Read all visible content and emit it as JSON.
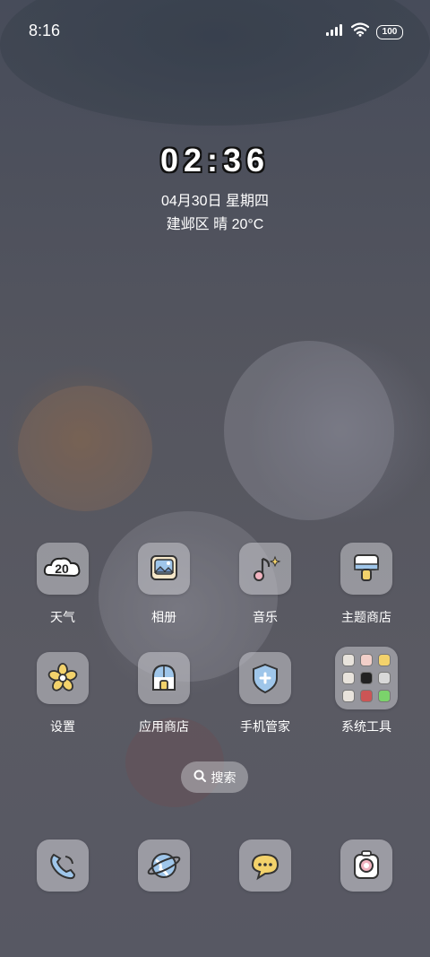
{
  "status_bar": {
    "time": "8:16",
    "battery": "100"
  },
  "clock": {
    "time": "02:36",
    "date": "04月30日 星期四",
    "weather": "建邺区 晴 20°C"
  },
  "apps": [
    {
      "label": "天气",
      "icon": "weather-icon",
      "badge": "20"
    },
    {
      "label": "相册",
      "icon": "gallery-icon"
    },
    {
      "label": "音乐",
      "icon": "music-icon"
    },
    {
      "label": "主题商店",
      "icon": "theme-store-icon"
    },
    {
      "label": "设置",
      "icon": "settings-icon"
    },
    {
      "label": "应用商店",
      "icon": "app-store-icon"
    },
    {
      "label": "手机管家",
      "icon": "security-icon"
    },
    {
      "label": "系统工具",
      "icon": "folder-icon"
    }
  ],
  "search": {
    "label": "搜索"
  },
  "dock": [
    {
      "icon": "phone-icon"
    },
    {
      "icon": "browser-icon"
    },
    {
      "icon": "messages-icon"
    },
    {
      "icon": "camera-icon"
    }
  ]
}
